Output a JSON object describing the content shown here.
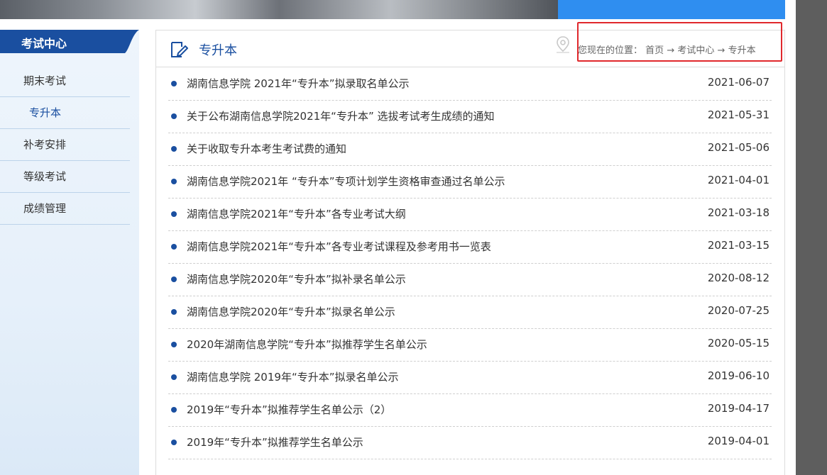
{
  "sidebar": {
    "title": "考试中心",
    "items": [
      {
        "label": "期末考试",
        "active": false
      },
      {
        "label": "专升本",
        "active": true
      },
      {
        "label": "补考安排",
        "active": false
      },
      {
        "label": "等级考试",
        "active": false
      },
      {
        "label": "成绩管理",
        "active": false
      }
    ]
  },
  "main": {
    "title": "专升本",
    "breadcrumb": {
      "prefix": "您现在的位置：",
      "home": "首页",
      "sep": "→",
      "center": "考试中心",
      "current": "专升本"
    },
    "news": [
      {
        "title": "湖南信息学院 2021年“专升本”拟录取名单公示",
        "date": "2021-06-07"
      },
      {
        "title": "关于公布湖南信息学院2021年“专升本” 选拔考试考生成绩的通知",
        "date": "2021-05-31"
      },
      {
        "title": "关于收取专升本考生考试费的通知",
        "date": "2021-05-06"
      },
      {
        "title": "湖南信息学院2021年 “专升本”专项计划学生资格审查通过名单公示",
        "date": "2021-04-01"
      },
      {
        "title": "湖南信息学院2021年“专升本”各专业考试大纲",
        "date": "2021-03-18"
      },
      {
        "title": "湖南信息学院2021年“专升本”各专业考试课程及参考用书一览表",
        "date": "2021-03-15"
      },
      {
        "title": "湖南信息学院2020年“专升本”拟补录名单公示",
        "date": "2020-08-12"
      },
      {
        "title": "湖南信息学院2020年“专升本”拟录名单公示",
        "date": "2020-07-25"
      },
      {
        "title": "2020年湖南信息学院“专升本”拟推荐学生名单公示",
        "date": "2020-05-15"
      },
      {
        "title": "湖南信息学院 2019年“专升本”拟录名单公示",
        "date": "2019-06-10"
      },
      {
        "title": "2019年“专升本”拟推荐学生名单公示（2）",
        "date": "2019-04-17"
      },
      {
        "title": "2019年“专升本”拟推荐学生名单公示",
        "date": "2019-04-01"
      }
    ]
  },
  "colors": {
    "accent": "#1a4fa0",
    "banner_blue": "#2f8ef0",
    "highlight": "#e0282c"
  }
}
